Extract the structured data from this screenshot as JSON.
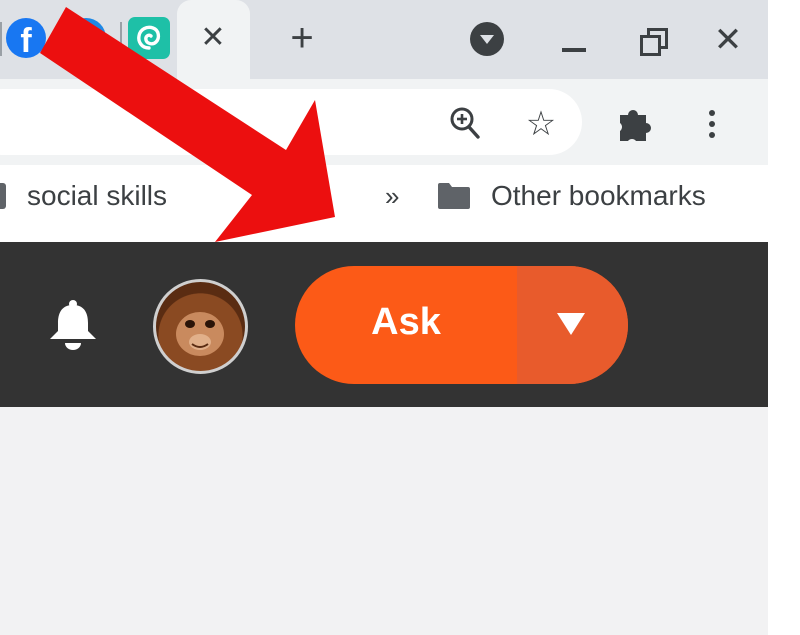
{
  "tab_strip": {
    "favicons": [
      "facebook-icon",
      "messenger-icon",
      "teal-spiral-icon"
    ],
    "active_tab_close_glyph": "✕",
    "new_tab_glyph": "+",
    "window_controls": {
      "minimize": "minimize-icon",
      "restore": "restore-icon",
      "close_glyph": "✕"
    }
  },
  "toolbar": {
    "zoom_icon": "zoom-in-icon",
    "star_glyph": "☆",
    "extensions_icon": "puzzle-icon",
    "menu_icon": "kebab-menu-icon"
  },
  "bookmarks": {
    "items": [
      {
        "label": "social skills",
        "icon": "folder-icon"
      }
    ],
    "overflow_glyph": "»",
    "other_label": "Other bookmarks"
  },
  "site_header": {
    "notifications_icon": "bell-icon",
    "avatar": "orangutan-avatar",
    "ask_button": {
      "label": "Ask",
      "dropdown_icon": "caret-down-icon"
    }
  },
  "annotation": {
    "arrow": "red-arrow-pointing-down-right"
  },
  "colors": {
    "tab_strip_bg": "#dee1e6",
    "toolbar_bg": "#f1f3f4",
    "site_header_bg": "#333333",
    "ask_button": "#fc5a17",
    "ask_dropdown": "#e85b2c",
    "page_bg": "#f2f2f3",
    "arrow": "#ec0f0f"
  }
}
